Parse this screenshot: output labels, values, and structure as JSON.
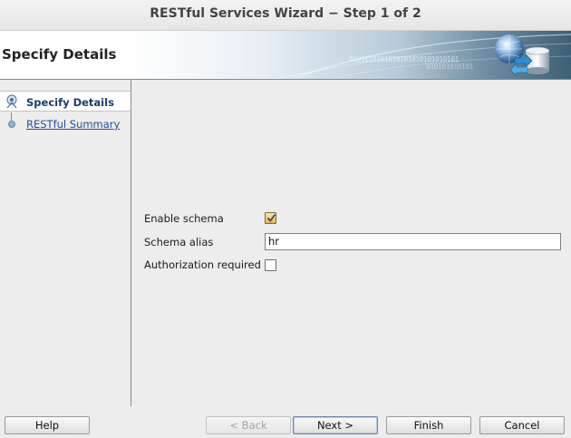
{
  "window": {
    "title": "RESTful Services Wizard − Step 1 of 2"
  },
  "banner": {
    "title": "Specify Details",
    "bits_line1": "0101010101010101010101010101",
    "bits_line2": "010101010101"
  },
  "steps": [
    {
      "label": "Specify Details",
      "state": "current"
    },
    {
      "label": "RESTful Summary",
      "state": "link"
    }
  ],
  "form": {
    "enable_schema": {
      "label": "Enable schema",
      "checked": true
    },
    "schema_alias": {
      "label": "Schema alias",
      "value": "hr"
    },
    "authorization_required": {
      "label": "Authorization required",
      "checked": false
    }
  },
  "buttons": {
    "help": "Help",
    "back": "< Back",
    "next": "Next >",
    "finish": "Finish",
    "cancel": "Cancel"
  },
  "colors": {
    "accent": "#1f4f9e",
    "checkbox_fill": "#e8b448",
    "banner_dark": "#3e6075"
  }
}
